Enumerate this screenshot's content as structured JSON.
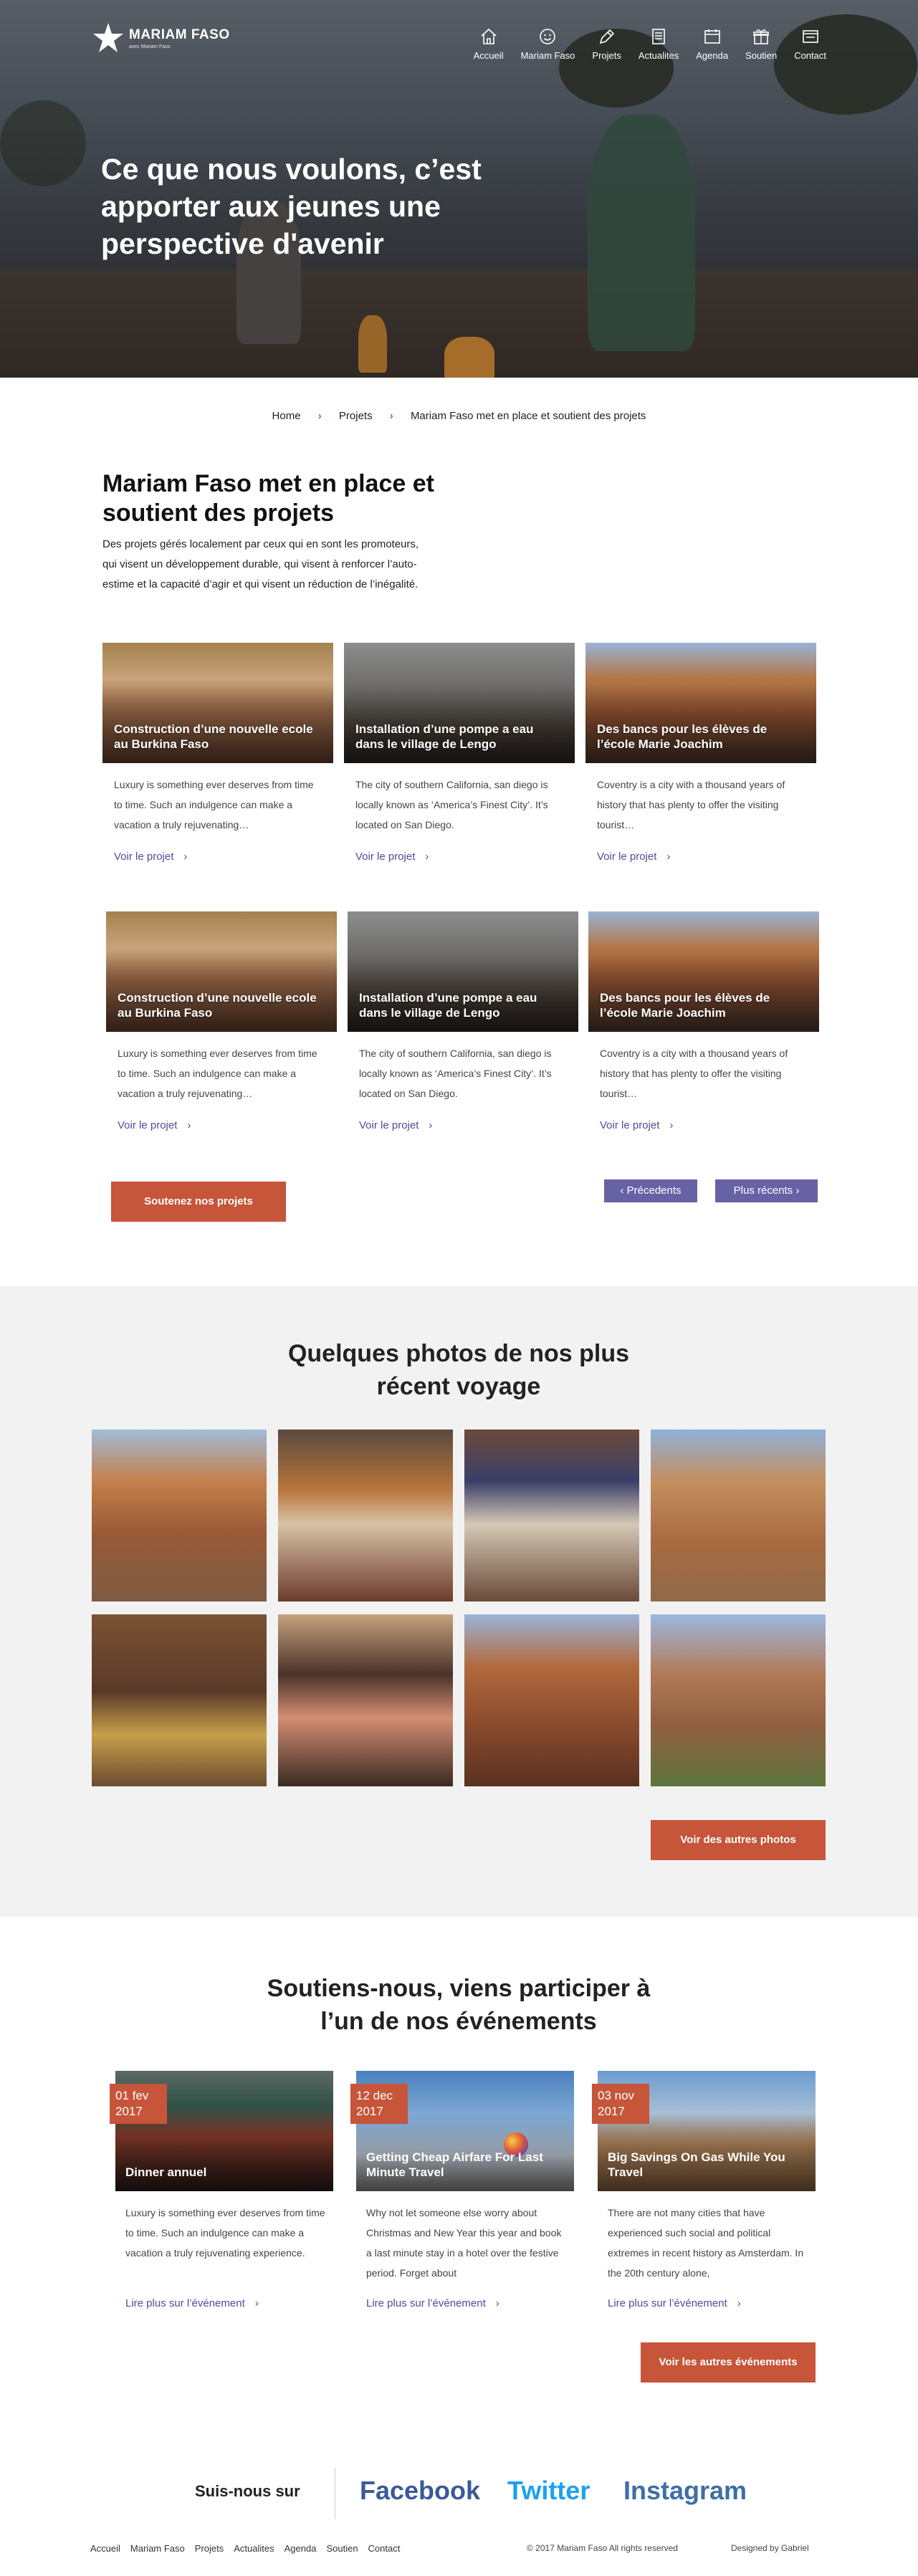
{
  "brand": {
    "name": "MARIAM FASO",
    "tagline": "avec Mariam Faso"
  },
  "nav": [
    {
      "label": "Accueil",
      "icon": "home-icon"
    },
    {
      "label": "Mariam Faso",
      "icon": "smile-icon"
    },
    {
      "label": "Projets",
      "icon": "pen-icon"
    },
    {
      "label": "Actualites",
      "icon": "document-icon"
    },
    {
      "label": "Agenda",
      "icon": "calendar-icon"
    },
    {
      "label": "Soutien",
      "icon": "gift-icon"
    },
    {
      "label": "Contact",
      "icon": "mail-icon"
    }
  ],
  "hero": {
    "title": "Ce que nous voulons, c’est apporter aux jeunes une perspective d'avenir"
  },
  "breadcrumb": {
    "home": "Home",
    "projects": "Projets",
    "current": "Mariam Faso met en place et soutient des projets"
  },
  "intro": {
    "title": "Mariam Faso met en place et soutient des projets",
    "text": "Des projets gérés localement par ceux qui en sont les promoteurs, qui visent un développement durable, qui visent à renforcer l’auto-estime et la capacité d’agir et qui visent un réduction de l’inégalité."
  },
  "projects": [
    {
      "title": "Construction d’une nouvelle ecole au Burkina Faso",
      "desc": "Luxury is something ever  deserves from time to time. Such an indulgence can make a vacation a truly rejuvenating…",
      "link": "Voir le projet"
    },
    {
      "title": "Installation d’une pompe a eau dans  le village de Lengo",
      "desc": "The city of southern California, san diego is locally known as ‘America’s Finest City’. It’s located on San Diego.",
      "link": "Voir le projet"
    },
    {
      "title": "Des bancs pour les élèves de l’école Marie Joachim",
      "desc": "Coventry is a city with a thousand years of history that has plenty to offer the visiting tourist…",
      "link": "Voir le projet"
    },
    {
      "title": "Construction d’une nouvelle ecole au Burkina Faso",
      "desc": "Luxury is something ever  deserves from time to time. Such an indulgence can make a vacation a truly rejuvenating…",
      "link": "Voir le projet"
    },
    {
      "title": "Installation d’une pompe a eau dans  le village de Lengo",
      "desc": "The city of southern California, san diego is locally known as ‘America’s Finest City’. It’s located on San Diego.",
      "link": "Voir le projet"
    },
    {
      "title": "Des bancs pour les élèves de l’école Marie Joachim",
      "desc": "Coventry is a city with a thousand years of history that has plenty to offer the visiting tourist…",
      "link": "Voir le projet"
    }
  ],
  "support_button": "Soutenez nos projets",
  "pagination": {
    "prev": "Précedents",
    "next": "Plus récents"
  },
  "photos": {
    "title": "Quelques photos de nos plus récent voyage",
    "button": "Voir des autres photos"
  },
  "events_section": {
    "title": "Soutiens-nous, viens participer à l’un de nos événements",
    "events": [
      {
        "day": "01 fev",
        "year": "2017",
        "title": "Dinner annuel",
        "desc": "Luxury is something ever  deserves from time to time. Such an indulgence can make a vacation a truly rejuvenating experience.",
        "link": "Lire plus sur l’événement"
      },
      {
        "day": "12 dec",
        "year": "2017",
        "title": "Getting Cheap Airfare For Last Minute Travel",
        "desc": "Why not let someone else worry about Christmas and New Year this year and book a last minute stay in a hotel over the festive period. Forget about",
        "link": "Lire plus sur l’événement"
      },
      {
        "day": "03 nov",
        "year": "2017",
        "title": "Big Savings On Gas While You Travel",
        "desc": "There are not many cities that have experienced such social and political extremes in recent history as Amsterdam. In the 20th century alone,",
        "link": "Lire plus sur l’événement"
      }
    ],
    "button": "Voir les autres événements"
  },
  "footer": {
    "follow": "Suis-nous sur",
    "social": [
      {
        "label": "Facebook",
        "color": "#3b5998"
      },
      {
        "label": "Twitter",
        "color": "#1da1f2"
      },
      {
        "label": "Instagram",
        "color": "#3f6ea6"
      }
    ],
    "nav": [
      "Accueil",
      "Mariam Faso",
      "Projets",
      "Actualites",
      "Agenda",
      "Soutien",
      "Contact"
    ],
    "copyright": "© 2017 Mariam Faso All rights reserved",
    "designed": "Designed by Gabriel"
  },
  "colors": {
    "accent": "#c6553a",
    "link": "#4e4c9b",
    "pager": "#6762a6",
    "section_bg": "#f2f2f2"
  }
}
